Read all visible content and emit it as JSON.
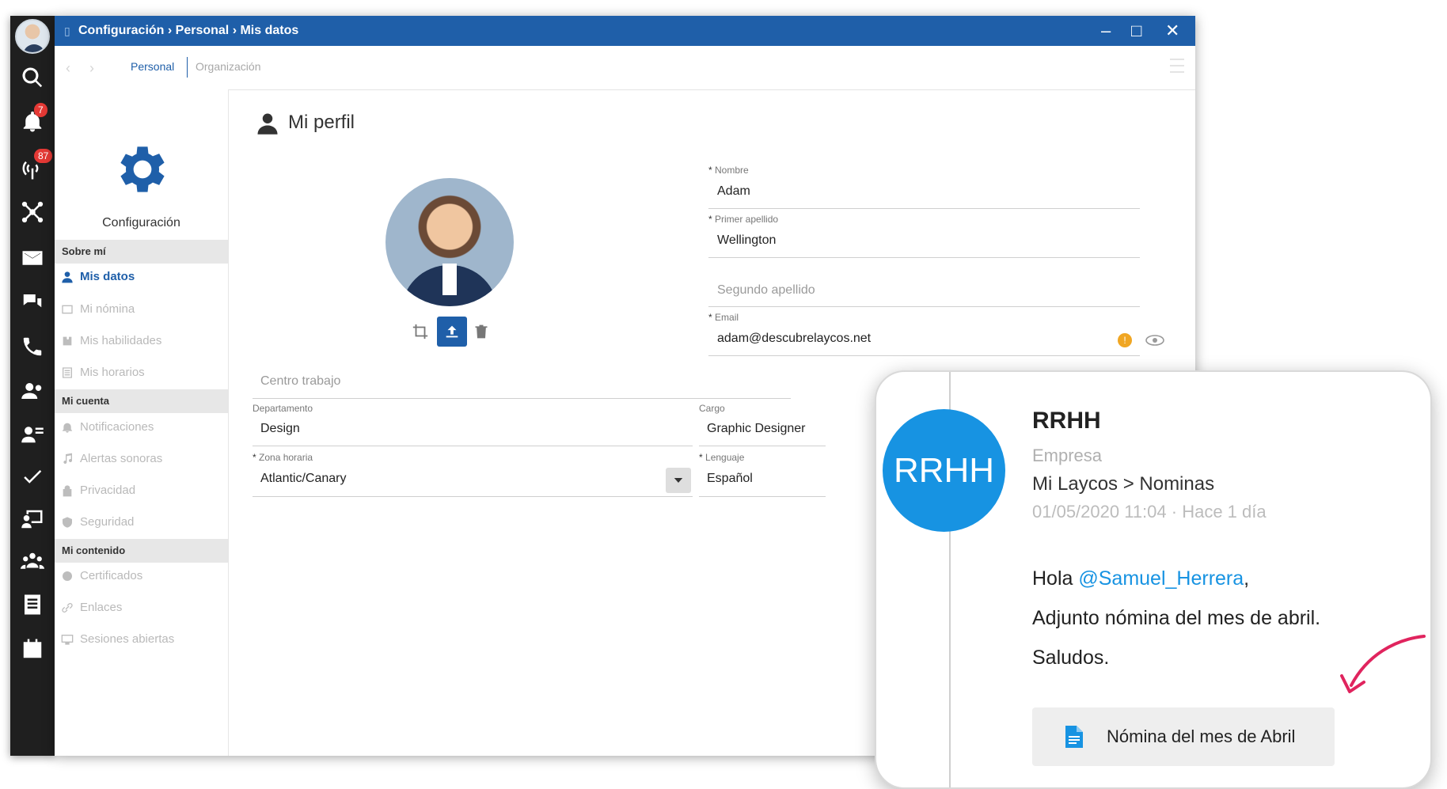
{
  "rail": {
    "badges": {
      "notifications": "7",
      "signal": "87"
    },
    "icons": [
      "search-icon",
      "bell-icon",
      "signal-icon",
      "network-icon",
      "mail-icon",
      "chat-icon",
      "phone-icon",
      "users-icon",
      "contact-card-icon",
      "check-icon",
      "presentation-icon",
      "team-icon",
      "document-icon",
      "calendar-icon"
    ]
  },
  "window": {
    "breadcrumb": "Configuración › Personal › Mis datos",
    "controls": {
      "minimize": "–",
      "maximize": "□",
      "close": "✕"
    }
  },
  "tabs": {
    "active": "Personal",
    "other": "Organización"
  },
  "sidebar": {
    "title": "Configuración",
    "sections": [
      {
        "label": "Sobre mí",
        "items": [
          "Mis datos",
          "Mi nómina",
          "Mis habilidades",
          "Mis horarios"
        ]
      },
      {
        "label": "Mi cuenta",
        "items": [
          "Notificaciones",
          "Alertas sonoras",
          "Privacidad",
          "Seguridad"
        ]
      },
      {
        "label": "Mi contenido",
        "items": [
          "Certificados",
          "Enlaces",
          "Sesiones abiertas"
        ]
      }
    ]
  },
  "profile": {
    "heading": "Mi perfil",
    "fields": {
      "nombre": {
        "label": "Nombre",
        "value": "Adam"
      },
      "primer_apellido": {
        "label": "Primer apellido",
        "value": "Wellington"
      },
      "segundo_apellido": {
        "placeholder": "Segundo apellido"
      },
      "email": {
        "label": "Email",
        "value": "adam@descubrelaycos.net"
      },
      "centro_trabajo": {
        "placeholder": "Centro trabajo"
      },
      "departamento": {
        "label": "Departamento",
        "value": "Design"
      },
      "cargo": {
        "label": "Cargo",
        "value": "Graphic Designer"
      },
      "zona_horaria": {
        "label": "Zona horaria",
        "value": "Atlantic/Canary"
      },
      "lenguaje": {
        "label": "Lenguaje",
        "value": "Español"
      }
    }
  },
  "notification_card": {
    "avatar_text": "RRHH",
    "sender": "RRHH",
    "sender_type": "Empresa",
    "path": "Mi Laycos > Nominas",
    "timestamp": "01/05/2020 11:04 · Hace 1 día",
    "greeting_prefix": "Hola ",
    "mention": "@Samuel_Herrera",
    "greeting_suffix": ",",
    "body": "Adjunto nómina del mes de abril.",
    "signoff": "Saludos.",
    "attachment": "Nómina del mes de Abril"
  },
  "colors": {
    "brand_blue": "#1f5fa9",
    "avatar_blue": "#1793e2",
    "badge_red": "#e53935",
    "arrow_pink": "#e0245e"
  }
}
